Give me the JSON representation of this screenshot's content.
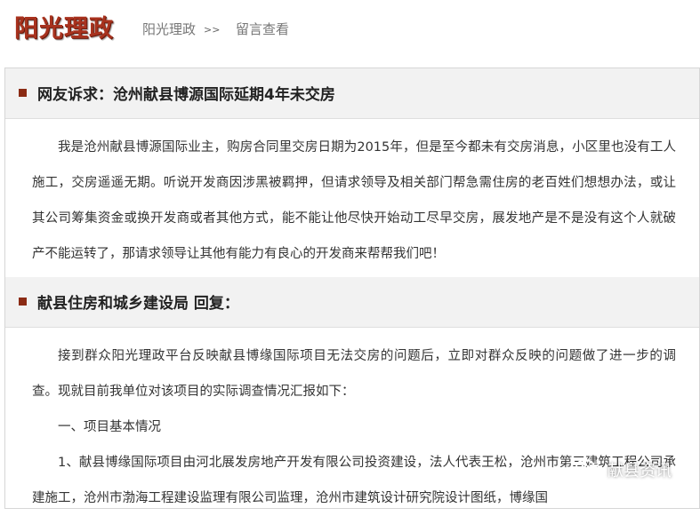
{
  "header": {
    "logo_text": "阳光理政",
    "breadcrumb_home": "阳光理政",
    "breadcrumb_sep": ">>",
    "breadcrumb_page": "留言查看"
  },
  "petition": {
    "title": "网友诉求：沧州献县博源国际延期4年未交房",
    "body": "我是沧州献县博源国际业主，购房合同里交房日期为2015年，但是至今都未有交房消息，小区里也没有工人施工，交房遥遥无期。听说开发商因涉黑被羁押，但请求领导及相关部门帮急需住房的老百姓们想想办法，或让其公司筹集资金或换开发商或者其他方式，能不能让他尽快开始动工尽早交房，展发地产是不是没有这个人就破产不能运转了，那请求领导让其他有能力有良心的开发商来帮帮我们吧！"
  },
  "reply": {
    "title": "献县住房和城乡建设局 回复：",
    "paragraphs": [
      "接到群众阳光理政平台反映献县博缘国际项目无法交房的问题后，立即对群众反映的问题做了进一步的调查。现就目前我单位对该项目的实际调查情况汇报如下：",
      "一、项目基本情况",
      "1、献县博缘国际项目由河北展发房地产开发有限公司投资建设，法人代表王松，沧州市第三建筑工程公司承建施工，沧州市渤海工程建设监理有限公司监理，沧州市建筑设计研究院设计图纸，博缘国"
    ]
  },
  "watermark": {
    "text": "献县资讯",
    "icon": "wechat-icon"
  },
  "colors": {
    "logo": "#a8321e",
    "bullet": "#8b2b14",
    "header_bg": "#f2f2f2"
  }
}
